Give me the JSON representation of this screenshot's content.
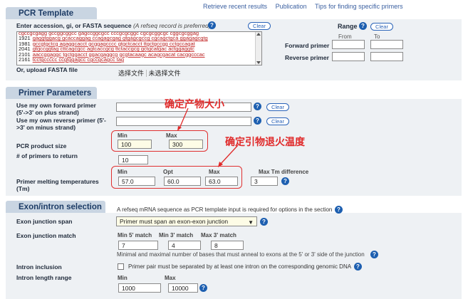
{
  "top_links": [
    "Retrieve recent results",
    "Publication",
    "Tips for finding specific primers"
  ],
  "pcr_template": {
    "header": "PCR Template",
    "accession_label": "Enter accession, gi, or FASTA sequence",
    "accession_hint": "(A refseq record is preferred)",
    "clear": "Clear",
    "sequence_lines": [
      {
        "num": "1921",
        "seq": "gaggtggacg gcaccaggag ccagagcgag gtgagcgccg cgcagctgca ggagagcgtg"
      },
      {
        "num": "1981",
        "seq": "gccgtgctcg agaggcacct gcggagcccc gtgctcacct ttgctgccgg cctgccagat"
      },
      {
        "num": "2041",
        "seq": "gtgccggtag cttcagcgcc agtcaccgcg ttctaccgcg gctgcatgac actggaggtc"
      },
      {
        "num": "2101",
        "seq": "aaccggaggc tgctggacct ggacgaggcg gcgtacaagc acagcgacat cacggcccac"
      },
      {
        "num": "2161",
        "seq": "tcctgccccc ccgtggagcc cgccgcagcc tag"
      }
    ],
    "upload_label": "Or, upload FASTA file",
    "choose_file": "选择文件",
    "no_file": "未选择文件",
    "range_label": "Range",
    "range_clear": "Clear",
    "from_label": "From",
    "to_label": "To",
    "forward_primer": "Forward primer",
    "reverse_primer": "Reverse primer"
  },
  "primer_params": {
    "header": "Primer Parameters",
    "own_forward": "Use my own forward primer",
    "own_forward_sub": "(5'->3' on plus strand)",
    "own_reverse": "Use my own reverse primer (5'-",
    "own_reverse_sub": ">3' on minus strand)",
    "clear": "Clear",
    "product_size_label": "PCR product size",
    "min_label": "Min",
    "max_label": "Max",
    "product_min": "100",
    "product_max": "300",
    "num_primers_label": "# of primers to return",
    "num_primers": "10",
    "tm_label": "Primer melting temperatures",
    "tm_label2": "(Tm)",
    "tm_min_label": "Min",
    "tm_opt_label": "Opt",
    "tm_max_label": "Max",
    "tm_min": "57.0",
    "tm_opt": "60.0",
    "tm_max": "63.0",
    "tm_diff_label": "Max Tm difference",
    "tm_diff": "3",
    "anno_size": "确定产物大小",
    "anno_tm": "确定引物退火温度"
  },
  "exon": {
    "header": "Exon/intron selection",
    "note": "A refseq mRNA sequence as PCR template input is required for options in the section",
    "junction_span_label": "Exon junction span",
    "junction_span_value": "Primer must span an exon-exon junction",
    "junction_match_label": "Exon junction match",
    "min5_label": "Min 5' match",
    "min3_label": "Min 3' match",
    "max3_label": "Max 3' match",
    "min5": "7",
    "min3": "4",
    "max3": "8",
    "match_desc": "Minimal and maximal number of bases that must anneal to exons at the 5' or 3' side of the junction",
    "intron_incl_label": "Intron inclusion",
    "intron_incl_text": "Primer pair must be separated by at least one intron on the corresponding genomic DNA",
    "intron_len_label": "Intron length range",
    "min_label": "Min",
    "max_label": "Max",
    "intron_min": "1000",
    "intron_max": "10000"
  },
  "colors": {
    "accent": "#1d5fb0",
    "annotation": "#e02a2a",
    "panel": "#eef1f4",
    "header": "#c9d5e2"
  }
}
